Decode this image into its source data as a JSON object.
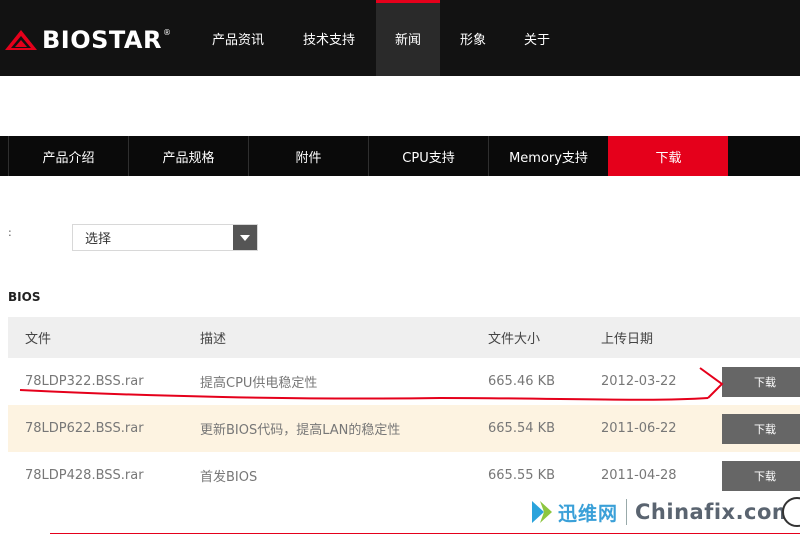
{
  "brand": {
    "name": "BIOSTAR",
    "reg": "®",
    "accent": "#e5001b"
  },
  "top_nav": [
    {
      "label": "产品资讯"
    },
    {
      "label": "技术支持"
    },
    {
      "label": "新闻",
      "active": true
    },
    {
      "label": "形象"
    },
    {
      "label": "关于"
    }
  ],
  "sub_nav": [
    {
      "label": "产品介绍"
    },
    {
      "label": "产品规格"
    },
    {
      "label": "附件"
    },
    {
      "label": "CPU支持"
    },
    {
      "label": "Memory支持"
    },
    {
      "label": "下载",
      "active": true
    }
  ],
  "filter": {
    "colon": ":",
    "selected": "选择"
  },
  "section": {
    "title": "BIOS"
  },
  "table": {
    "headers": {
      "file": "文件",
      "desc": "描述",
      "size": "文件大小",
      "date": "上传日期"
    },
    "rows": [
      {
        "file": "78LDP322.BSS.rar",
        "desc": "提高CPU供电稳定性",
        "size": "665.46 KB",
        "date": "2012-03-22",
        "action": "下载"
      },
      {
        "file": "78LDP622.BSS.rar",
        "desc": "更新BIOS代码，提高LAN的稳定性",
        "size": "665.54 KB",
        "date": "2011-06-22",
        "action": "下载"
      },
      {
        "file": "78LDP428.BSS.rar",
        "desc": "首发BIOS",
        "size": "665.55 KB",
        "date": "2011-04-28",
        "action": "下载"
      }
    ]
  },
  "watermark": {
    "cn": "迅维网",
    "en": "Chinafix.com"
  }
}
